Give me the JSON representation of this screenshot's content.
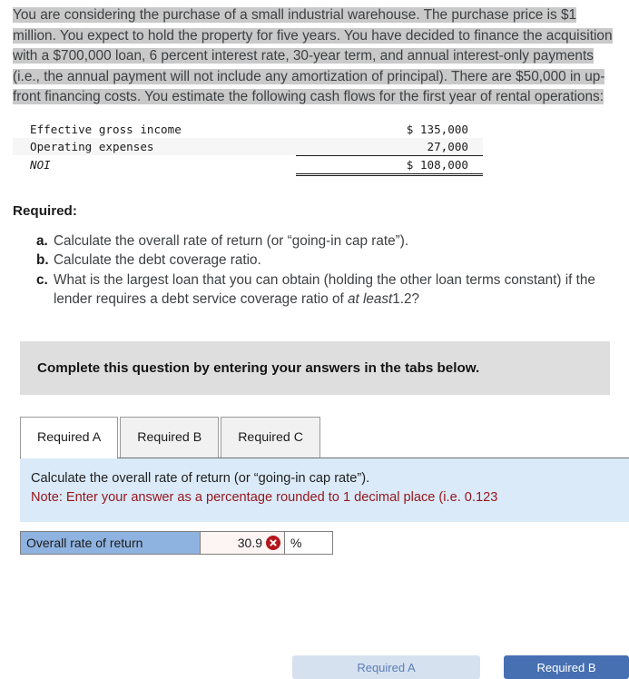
{
  "problem": {
    "text": "You are considering the purchase of a small industrial warehouse. The purchase price is $1 million. You expect to hold the property for five years. You have decided to finance the acquisition with a $700,000 loan, 6 percent interest rate, 30-year term, and annual interest-only payments (i.e., the annual payment will not include any amortization of principal). There are $50,000 in up-front financing costs. You estimate the following cash flows for the first year of rental operations:"
  },
  "financials": {
    "rows": [
      {
        "label": "Effective gross income",
        "amount": "$ 135,000"
      },
      {
        "label": "Operating expenses",
        "amount": "27,000"
      },
      {
        "label": "NOI",
        "amount": "$ 108,000"
      }
    ]
  },
  "required": {
    "heading": "Required:",
    "items": [
      {
        "marker": "a.",
        "text": "Calculate the overall rate of return (or “going-in cap rate”)."
      },
      {
        "marker": "b.",
        "text": "Calculate the debt coverage ratio."
      },
      {
        "marker": "c.",
        "text": "What is the largest loan that you can obtain (holding the other loan terms constant) if the lender requires a debt service coverage ratio of ",
        "emphasis": "at least",
        "text_after": "1.2?"
      }
    ]
  },
  "banner": {
    "text": "Complete this question by entering your answers in the tabs below."
  },
  "tabs": [
    {
      "label": "Required A",
      "active": true
    },
    {
      "label": "Required B",
      "active": false
    },
    {
      "label": "Required C",
      "active": false
    }
  ],
  "panel": {
    "prompt": "Calculate the overall rate of return (or “going-in cap rate”).",
    "note": "Note: Enter your answer as a percentage rounded to 1 decimal place (i.e. 0.123"
  },
  "answer": {
    "label": "Overall rate of return",
    "value": "30.9",
    "unit": "%",
    "status_icon": "error-x-icon"
  },
  "buttons": {
    "previous": "Required A",
    "next": "Required B"
  },
  "colors": {
    "highlight": "#c9c9c9",
    "panel_bg": "#daeaf8",
    "note_text": "#96161c",
    "answer_label_bg": "#8fb3e0",
    "error_badge": "#b5161c",
    "primary_button": "#4670b2"
  }
}
